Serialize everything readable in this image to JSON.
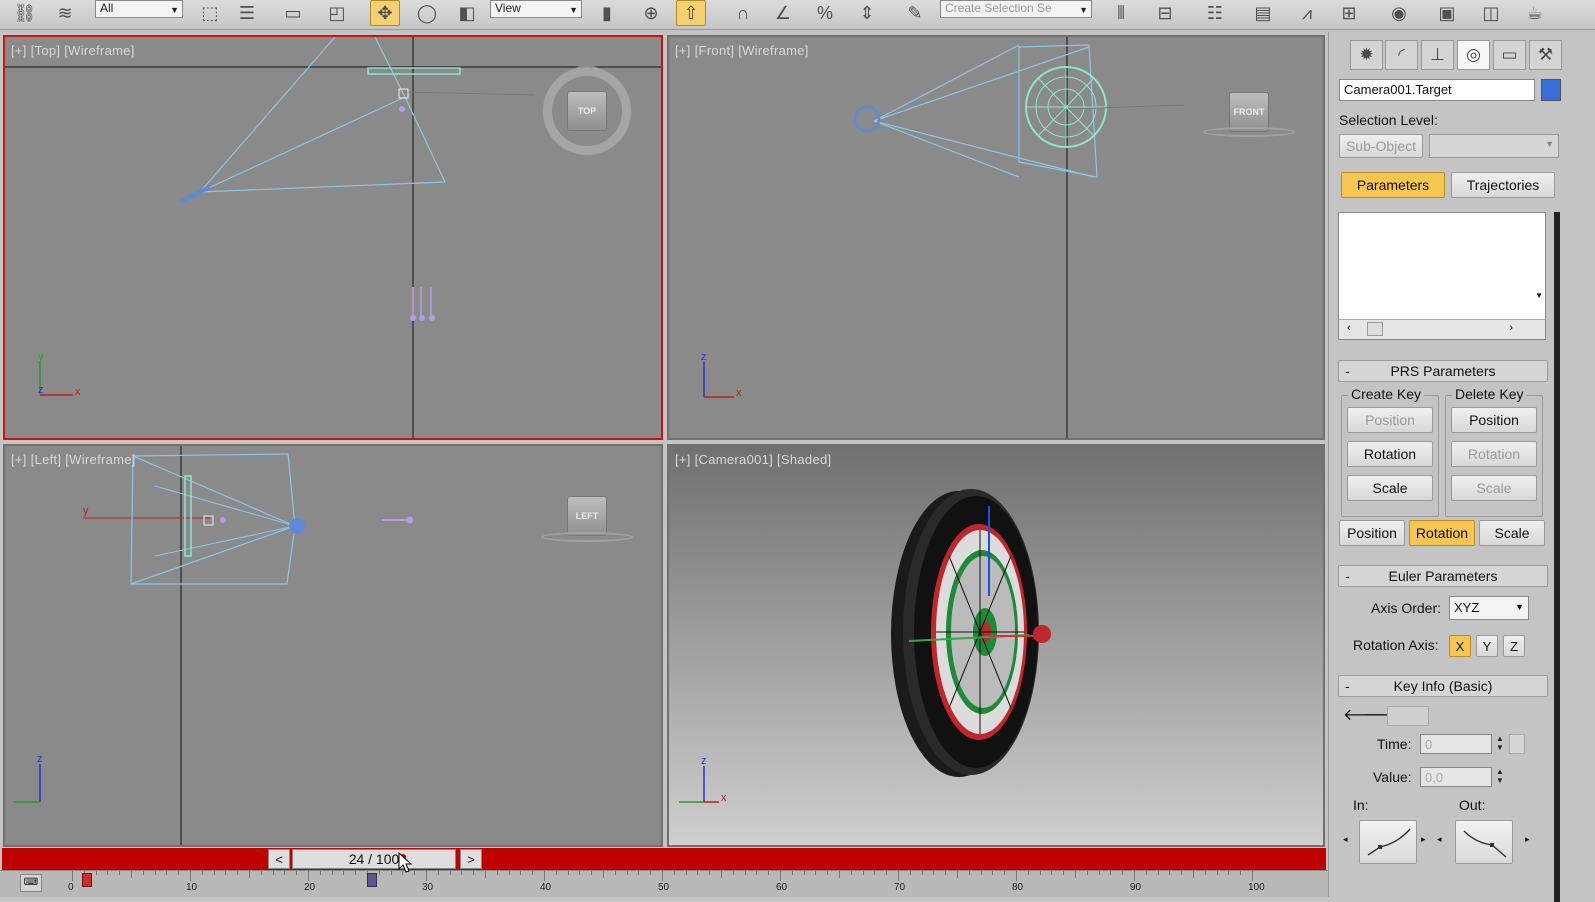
{
  "toolbar": {
    "selection_filter": "All",
    "ref_coord": "View",
    "named_selection_placeholder": "Create Selection Se",
    "icons": [
      "undo-icon",
      "link-icon",
      "bind-icon",
      "select-icon",
      "select-by-name-icon",
      "rect-select-icon",
      "window-crossing-icon",
      "move-icon",
      "rotate-icon",
      "scale-icon",
      "pivot-icon",
      "select-manipulate-icon",
      "snap-2d-icon",
      "angle-snap-icon",
      "percent-snap-icon",
      "spinner-snap-icon",
      "edit-named-sel-icon",
      "mirror-icon",
      "align-icon",
      "layers-icon",
      "curve-editor-icon",
      "schematic-icon",
      "material-editor-icon",
      "render-setup-icon",
      "render-frame-icon",
      "render-icon"
    ]
  },
  "viewports": {
    "top": {
      "label": "[+] [Top] [Wireframe]",
      "cube_label": "TOP"
    },
    "front": {
      "label": "[+] [Front] [Wireframe]",
      "cube_label": "FRONT"
    },
    "left": {
      "label": "[+] [Left] [Wireframe]",
      "cube_label": "LEFT"
    },
    "camera": {
      "label": "[+] [Camera001] [Shaded]"
    },
    "axis": {
      "x": "x",
      "y": "y",
      "z": "z"
    }
  },
  "command_panel": {
    "object_name": "Camera001.Target",
    "object_color": "#3a6fd8",
    "selection_level_label": "Selection Level:",
    "sub_object_button": "Sub-Object",
    "tabs": {
      "parameters": "Parameters",
      "trajectories": "Trajectories"
    },
    "prs": {
      "title": "PRS Parameters",
      "create_key": "Create Key",
      "delete_key": "Delete Key",
      "create_position": "Position",
      "create_rotation": "Rotation",
      "create_scale": "Scale",
      "delete_position": "Position",
      "delete_rotation": "Rotation",
      "delete_scale": "Scale",
      "mode_position": "Position",
      "mode_rotation": "Rotation",
      "mode_scale": "Scale"
    },
    "euler": {
      "title": "Euler Parameters",
      "axis_order_label": "Axis Order:",
      "axis_order_value": "XYZ",
      "rotation_axis_label": "Rotation Axis:",
      "axis_x": "X",
      "axis_y": "Y",
      "axis_z": "Z"
    },
    "key_info": {
      "title": "Key Info (Basic)",
      "time_label": "Time:",
      "time_value": "0",
      "value_label": "Value:",
      "value_value": "0,0",
      "in_label": "In:",
      "out_label": "Out:"
    }
  },
  "time_slider": {
    "frame_display": "24 / 100",
    "prev": "<",
    "next": ">",
    "tick_labels": [
      "0",
      "10",
      "20",
      "30",
      "40",
      "50",
      "60",
      "70",
      "80",
      "90",
      "100"
    ]
  }
}
